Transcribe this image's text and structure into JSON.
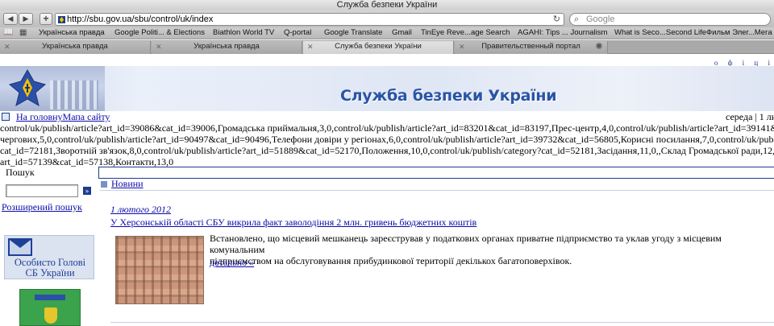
{
  "window": {
    "title": "Служба безпеки України"
  },
  "toolbar": {
    "back_label": "◀",
    "forward_label": "▶",
    "add_label": "+",
    "url": "http://sbu.gov.ua/sbu/control/uk/index",
    "search_placeholder": "Google"
  },
  "bookmarks": [
    "Українська правда",
    "Google Politi... & Elections",
    "Biathlon World TV",
    "Q-portal",
    "Google Translate",
    "Gmail",
    "TinEye Reve...age Search",
    "AGAHI: Tips ... Journalism",
    "What is Seco...Second Life",
    "Фильм Элег...Мега"
  ],
  "tabs": [
    {
      "label": "Українська правда",
      "active": false
    },
    {
      "label": "Українська правда",
      "active": false
    },
    {
      "label": "Служба безпеки України",
      "active": true
    },
    {
      "label": "Правительственный портал",
      "active": false
    }
  ],
  "page": {
    "official": "о ф і ц і",
    "banner_title": "Служба безпеки України",
    "home_links": "На головнуМапа сайту",
    "date": "середа | 1 лю",
    "raw_lines": [
      "control/uk/publish/article?art_id=39086&cat_id=39006,Громадська приймальня,3,0,control/uk/publish/article?art_id=83201&cat_id=83197,Прес-центр,4,0,control/uk/publish/article?art_id=39141&cat_id",
      "чергових,5,0,control/uk/publish/article?art_id=90497&cat_id=90496,Телефони довіри у регіонах,6,0,control/uk/publish/article?art_id=39732&cat_id=56805,Корисні посилання,7,0,control/uk/publish/",
      "cat_id=72181,Зворотній зв'язок,8,0,control/uk/publish/article?art_id=51889&cat_id=52170,Положення,10,0,control/uk/publish/category?cat_id=52181,Засідання,11,0,,Склад Громадської ради,12,0,c",
      "art_id=57139&cat_id=57138,Контакти,13,0"
    ],
    "sidebar": {
      "search_label": "Пошук",
      "search_button": "»",
      "advanced_search": "Розширений пошук",
      "personal_line1": "Особисто Голові",
      "personal_line2": "СБ України"
    },
    "main": {
      "section_link": "Новини",
      "news_date": "1 лютого 2012",
      "news_title": "У Херсонській області СБУ викрила факт заволодіння 2 млн. гривень бюджетних коштів",
      "news_body_line1": "Встановлено, що місцевий мешканець зареєстрував у податкових органах приватне підприємство та уклав угоду з місцевим комунальним",
      "news_body_line2": "підприємством на обслуговування прибудинкової території декількох багатоповерхівок.",
      "news_more": "детально »"
    }
  }
}
